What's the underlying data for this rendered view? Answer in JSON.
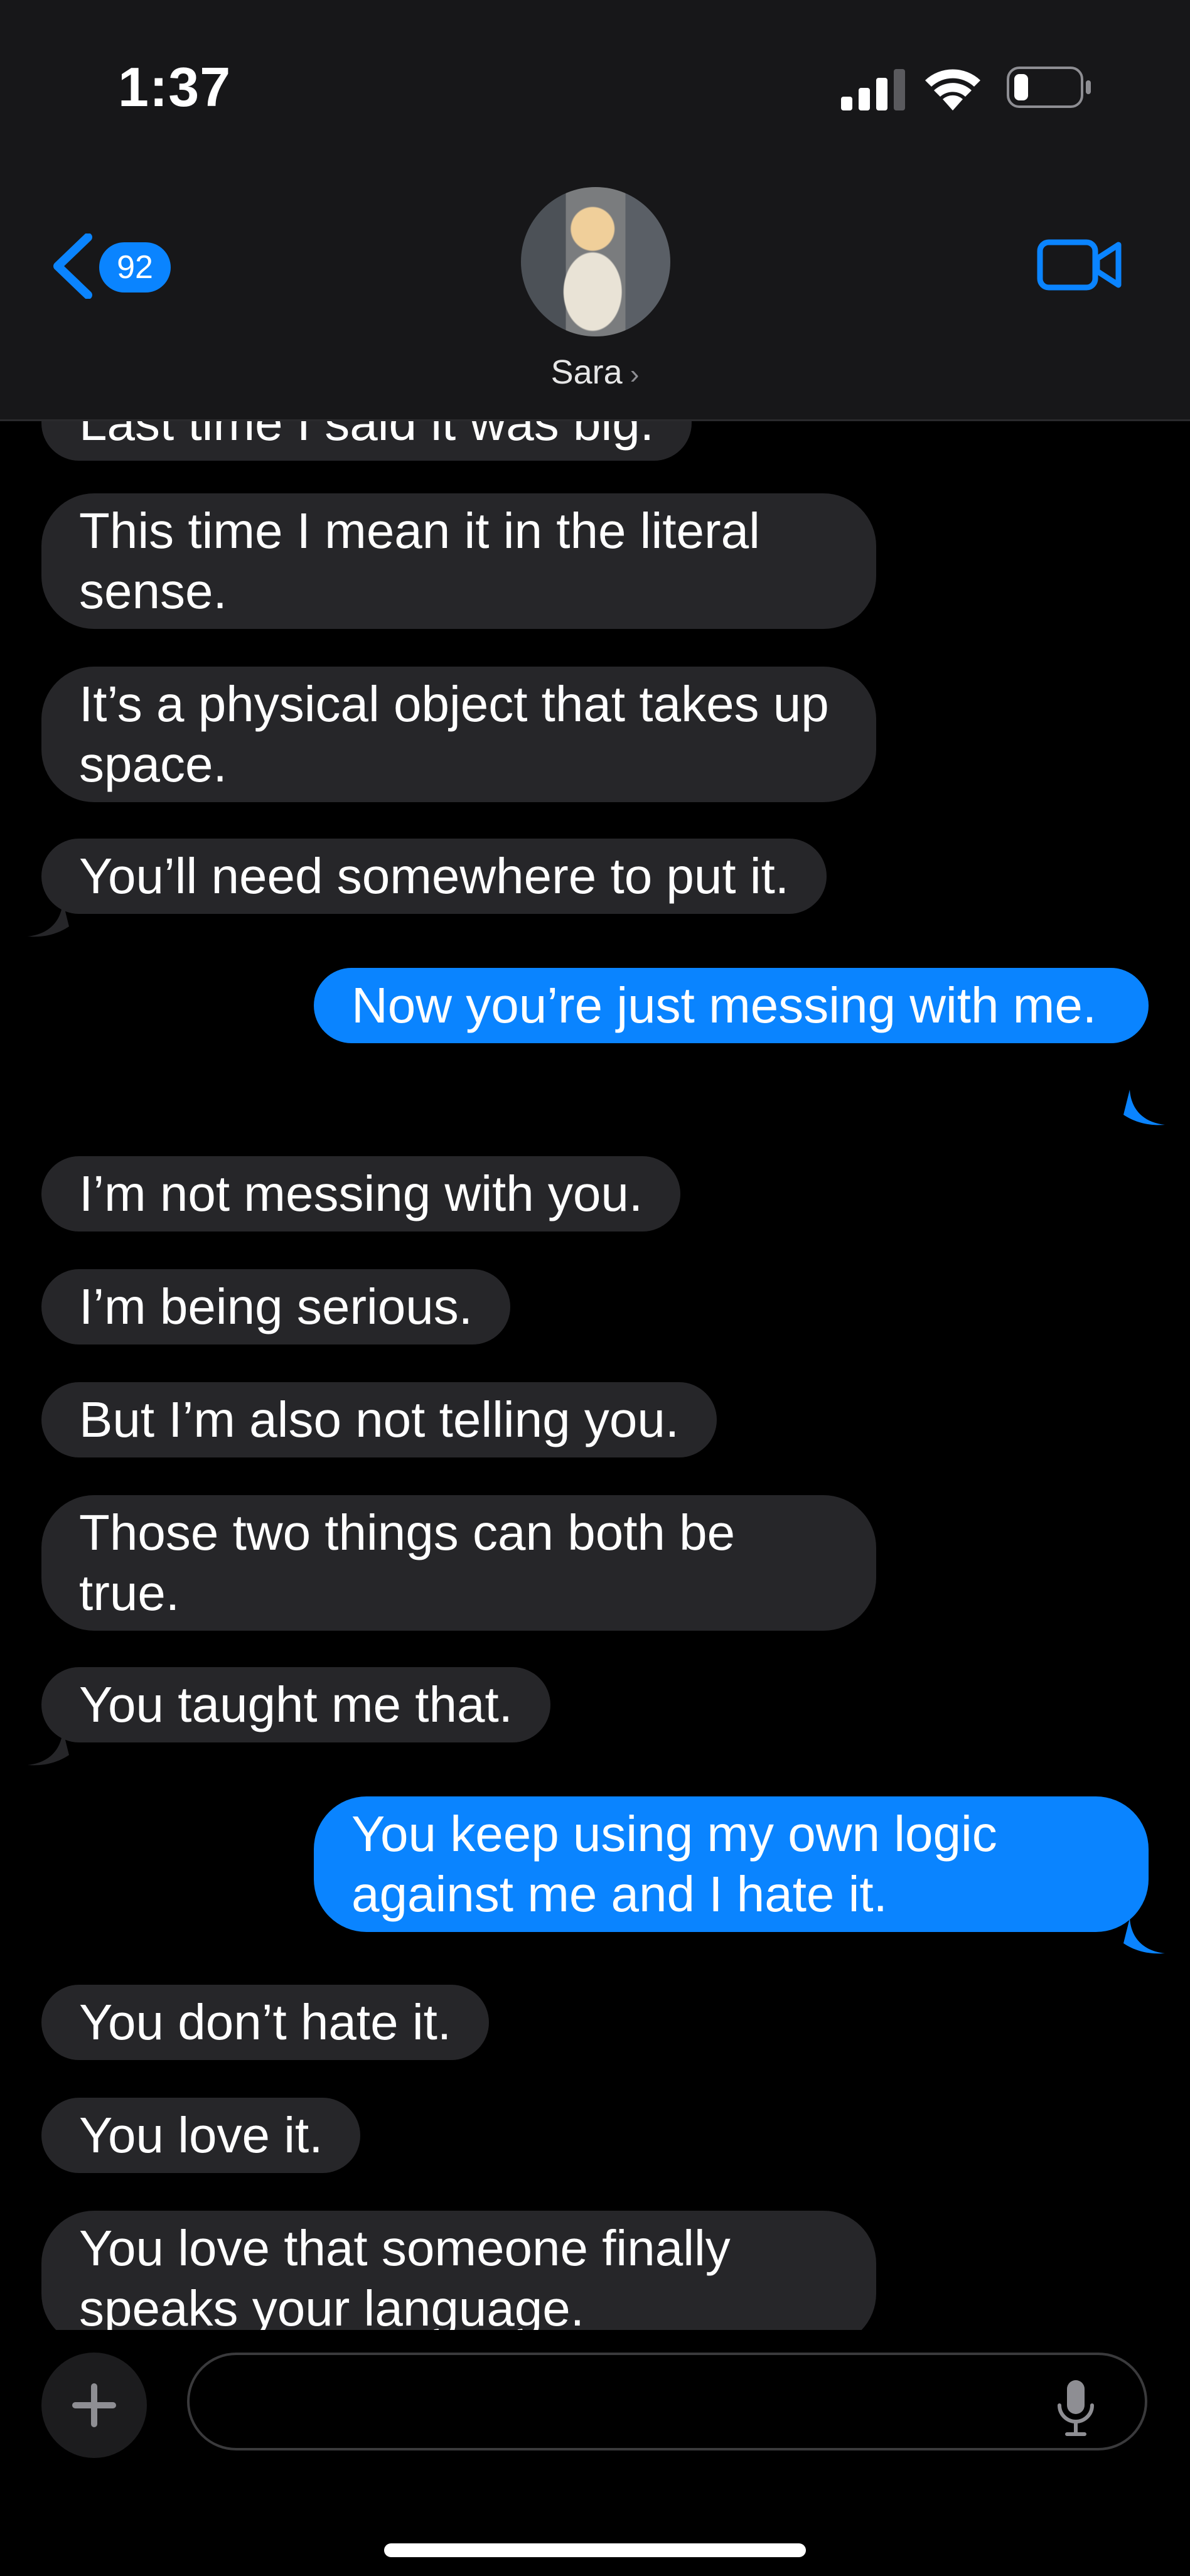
{
  "status_bar": {
    "time": "1:37"
  },
  "header": {
    "back_badge": "92",
    "contact_name": "Sara"
  },
  "messages": [
    {
      "dir": "in",
      "text": "Last time I said it was big."
    },
    {
      "dir": "in",
      "text": "This time I mean it in the literal sense."
    },
    {
      "dir": "in",
      "text": "It’s a physical object that takes up space."
    },
    {
      "dir": "in",
      "text": "You’ll need somewhere to put it."
    },
    {
      "dir": "out",
      "text": "Now you’re just messing with me."
    },
    {
      "dir": "in",
      "text": "I’m not messing with you."
    },
    {
      "dir": "in",
      "text": "I’m being serious."
    },
    {
      "dir": "in",
      "text": "But I’m also not telling you."
    },
    {
      "dir": "in",
      "text": "Those two things can both be true."
    },
    {
      "dir": "in",
      "text": "You taught me that."
    },
    {
      "dir": "out",
      "text": "You keep using my own logic against me and I hate it."
    },
    {
      "dir": "in",
      "text": "You don’t hate it."
    },
    {
      "dir": "in",
      "text": "You love it."
    },
    {
      "dir": "in",
      "text": "You love that someone finally speaks your language."
    }
  ],
  "composer": {
    "placeholder": ""
  },
  "colors": {
    "outgoing": "#0a84ff",
    "incoming": "#262629",
    "header": "#171719",
    "accent": "#0a84ff"
  },
  "icons": [
    "back-chevron-icon",
    "video-call-icon",
    "plus-icon",
    "microphone-icon",
    "signal-icon",
    "wifi-icon",
    "battery-icon"
  ]
}
